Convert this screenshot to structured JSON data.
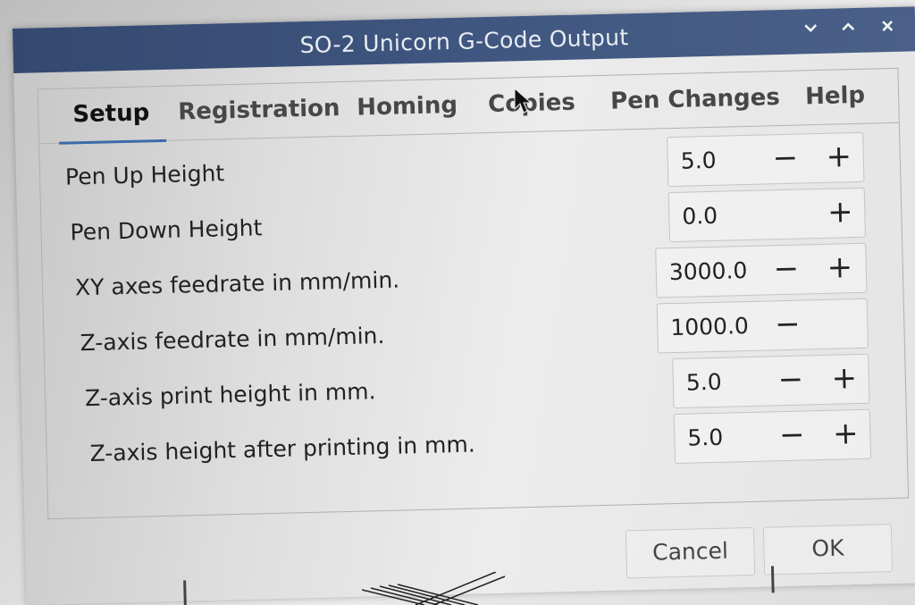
{
  "window": {
    "title": "SO-2 Unicorn G-Code Output",
    "controls": {
      "minimize_icon": "chevron-down",
      "maximize_icon": "chevron-up",
      "close_icon": "x"
    }
  },
  "tabs": [
    {
      "label": "Setup",
      "active": true
    },
    {
      "label": "Registration",
      "active": false
    },
    {
      "label": "Homing",
      "active": false
    },
    {
      "label": "Copies",
      "active": false
    },
    {
      "label": "Pen Changes",
      "active": false
    },
    {
      "label": "Help",
      "active": false
    }
  ],
  "settings": [
    {
      "label": "Pen Up Height",
      "value": "5.0",
      "minus": "−",
      "plus": "+"
    },
    {
      "label": "Pen Down Height",
      "value": "0.0",
      "minus": "",
      "plus": "+"
    },
    {
      "label": "XY axes feedrate in mm/min.",
      "value": "3000.0",
      "minus": "−",
      "plus": "+"
    },
    {
      "label": "Z-axis feedrate in mm/min.",
      "value": "1000.0",
      "minus": "−",
      "plus": ""
    },
    {
      "label": "Z-axis print height in mm.",
      "value": "5.0",
      "minus": "−",
      "plus": "+"
    },
    {
      "label": "Z-axis height after printing in mm.",
      "value": "5.0",
      "minus": "−",
      "plus": "+"
    }
  ],
  "buttons": {
    "cancel": "Cancel",
    "ok": "OK"
  },
  "colors": {
    "titlebar": "#3f5680",
    "active_tab_underline": "#3a6ca8"
  }
}
